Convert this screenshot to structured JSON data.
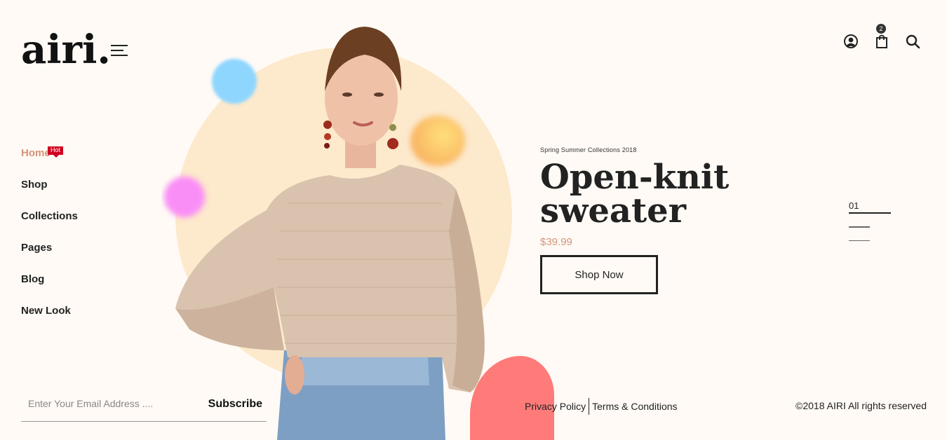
{
  "brand": {
    "logo": "airi."
  },
  "header": {
    "cart_count": "2"
  },
  "nav": {
    "items": [
      {
        "label": "Home"
      },
      {
        "label": "Shop",
        "badge": "Hot"
      },
      {
        "label": "Collections"
      },
      {
        "label": "Pages"
      },
      {
        "label": "Blog"
      },
      {
        "label": "New Look"
      }
    ]
  },
  "hero": {
    "tag": "Spring Summer Collections 2018",
    "title": "Open-knit sweater",
    "price": "$39.99",
    "cta_label": "Shop Now"
  },
  "slider": {
    "current": "01"
  },
  "subscribe": {
    "placeholder": "Enter Your Email Address ....",
    "button_label": "Subscribe"
  },
  "footer": {
    "privacy": "Privacy Policy",
    "terms": "Terms & Conditions",
    "copyright": "©2018 AIRI All rights reserved"
  },
  "colors": {
    "accent": "#d4947a",
    "hot_badge": "#d00021",
    "background": "#fffaf5"
  },
  "icons": [
    "menu-icon",
    "user-icon",
    "cart-icon",
    "search-icon"
  ]
}
